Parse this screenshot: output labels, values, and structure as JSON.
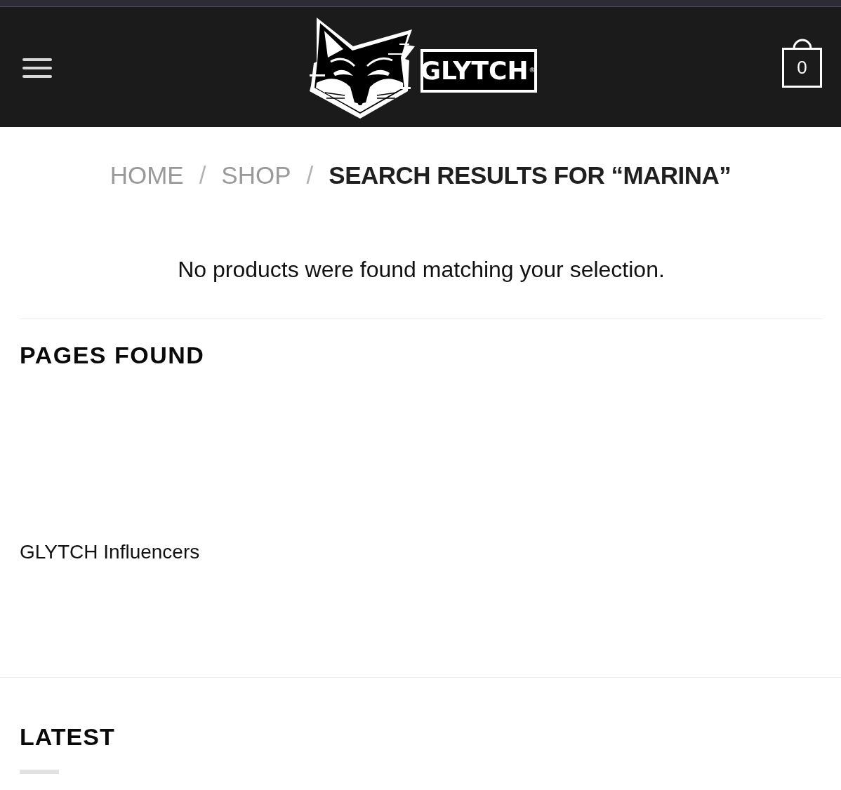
{
  "header": {
    "logo_wordmark": "GLYTCH$^{®}$",
    "cart_count": "0"
  },
  "breadcrumb": [
    {
      "label": "HOME",
      "current": false
    },
    {
      "separator": "/",
      "label": "SHOP",
      "current": false
    },
    {
      "separator": "/",
      "label": "SEARCH RESULTS FOR “MARINA”",
      "current": true
    }
  ],
  "message": "No products were found matching your selection.",
  "pages_found": {
    "heading": "PAGES FOUND",
    "pages": [
      {
        "title": "GLYTCH Influencers"
      }
    ]
  },
  "latest": {
    "heading": "LATEST"
  }
}
